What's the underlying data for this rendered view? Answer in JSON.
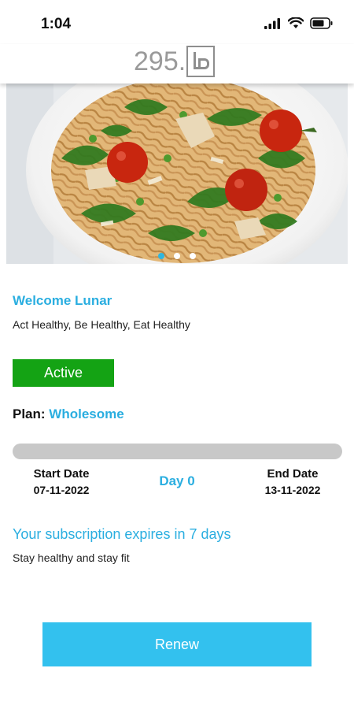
{
  "status_bar": {
    "time": "1:04",
    "icons": [
      "signal-icon",
      "wifi-icon",
      "battery-icon"
    ]
  },
  "header": {
    "logo_text": "295."
  },
  "banner": {
    "image": "pasta-salad-photo",
    "carousel": {
      "count": 3,
      "active_index": 0
    }
  },
  "user": {
    "welcome": "Welcome Lunar",
    "tagline": "Act Healthy, Be Healthy, Eat Healthy"
  },
  "subscription": {
    "status": "Active",
    "status_color": "#14a314",
    "plan_label": "Plan:",
    "plan_name": "Wholesome",
    "progress": 0,
    "start_label": "Start Date",
    "start_date": "07-11-2022",
    "day_counter": "Day 0",
    "end_label": "End Date",
    "end_date": "13-11-2022",
    "expiry_text": "Your subscription expires in 7 days",
    "message": "Stay healthy and stay fit"
  },
  "actions": {
    "renew_label": "Renew"
  },
  "colors": {
    "accent": "#2aaee0",
    "button": "#33c1ee",
    "active_badge": "#14a314",
    "progress_track": "#c8c8c8"
  }
}
